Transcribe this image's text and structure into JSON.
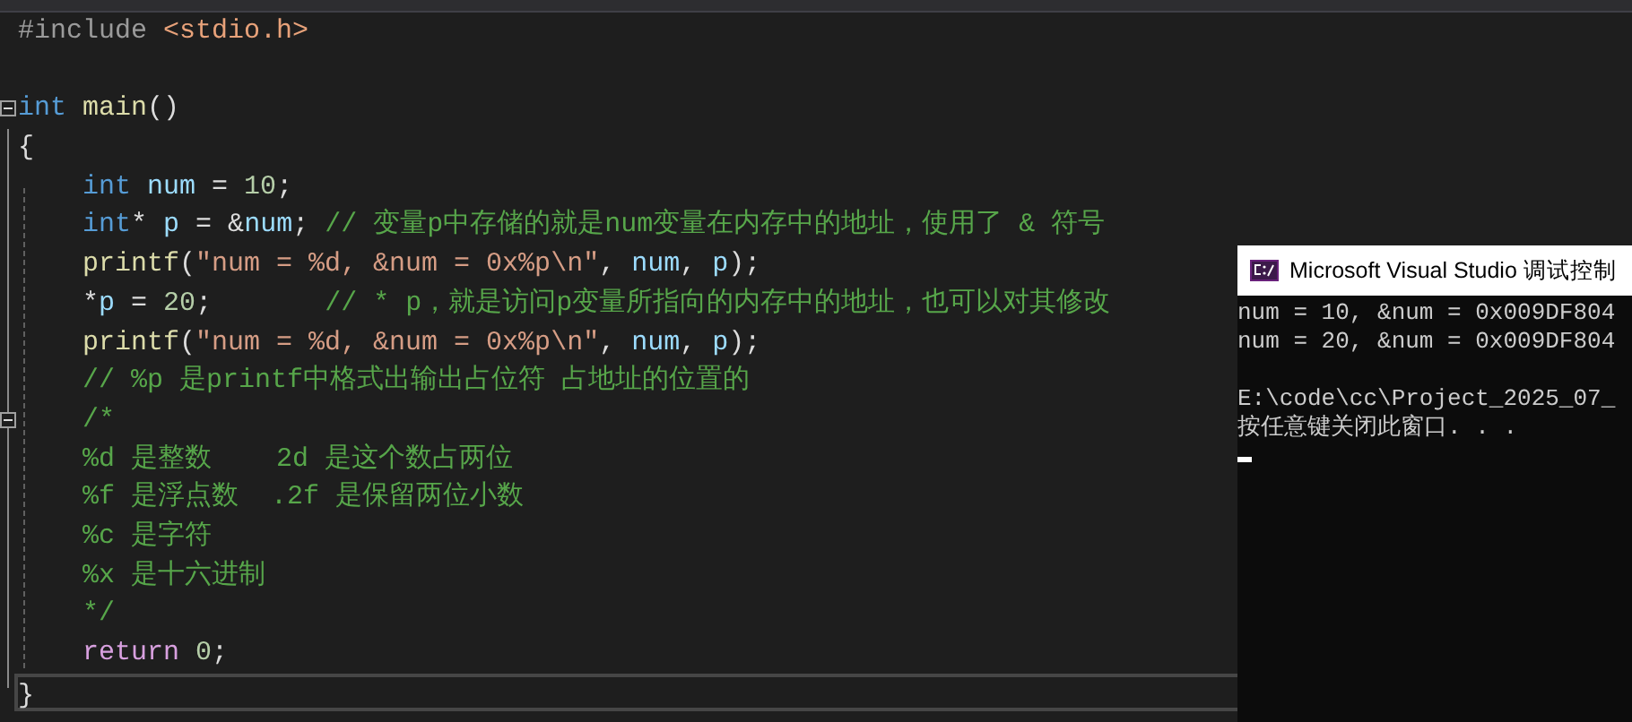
{
  "editor": {
    "lines": [
      {
        "kind": "code",
        "indented": false,
        "collapsible": false,
        "current": false,
        "tokens": [
          {
            "kind": "preproc",
            "text": "#include "
          },
          {
            "kind": "include",
            "text": "<stdio.h>"
          }
        ]
      },
      {
        "kind": "blank",
        "collapsible": false,
        "current": false
      },
      {
        "kind": "code",
        "indented": false,
        "collapsible": true,
        "current": false,
        "tokens": [
          {
            "kind": "keyword",
            "text": "int "
          },
          {
            "kind": "function",
            "text": "main"
          },
          {
            "kind": "plain",
            "text": "()"
          }
        ]
      },
      {
        "kind": "code",
        "indented": false,
        "collapsible": false,
        "current": false,
        "tokens": [
          {
            "kind": "plain",
            "text": "{"
          }
        ]
      },
      {
        "kind": "code",
        "indented": true,
        "collapsible": false,
        "current": false,
        "tokens": [
          {
            "kind": "keyword",
            "text": "int "
          },
          {
            "kind": "variable",
            "text": "num"
          },
          {
            "kind": "plain",
            "text": " = "
          },
          {
            "kind": "number",
            "text": "10"
          },
          {
            "kind": "plain",
            "text": ";"
          }
        ]
      },
      {
        "kind": "code",
        "indented": true,
        "collapsible": false,
        "current": false,
        "tokens": [
          {
            "kind": "keyword",
            "text": "int"
          },
          {
            "kind": "plain",
            "text": "* "
          },
          {
            "kind": "variable",
            "text": "p"
          },
          {
            "kind": "plain",
            "text": " = &"
          },
          {
            "kind": "variable",
            "text": "num"
          },
          {
            "kind": "plain",
            "text": "; "
          },
          {
            "kind": "comment",
            "text": "// 变量p中存储的就是num变量在内存中的地址，使用了 & 符号"
          }
        ]
      },
      {
        "kind": "code",
        "indented": true,
        "collapsible": false,
        "current": false,
        "tokens": [
          {
            "kind": "function",
            "text": "printf"
          },
          {
            "kind": "plain",
            "text": "("
          },
          {
            "kind": "string",
            "text": "\"num = %d, &num = 0x%p\\n\""
          },
          {
            "kind": "plain",
            "text": ", "
          },
          {
            "kind": "variable",
            "text": "num"
          },
          {
            "kind": "plain",
            "text": ", "
          },
          {
            "kind": "variable",
            "text": "p"
          },
          {
            "kind": "plain",
            "text": ");"
          }
        ]
      },
      {
        "kind": "code",
        "indented": true,
        "collapsible": false,
        "current": false,
        "tokens": [
          {
            "kind": "plain",
            "text": "*"
          },
          {
            "kind": "variable",
            "text": "p"
          },
          {
            "kind": "plain",
            "text": " = "
          },
          {
            "kind": "number",
            "text": "20"
          },
          {
            "kind": "plain",
            "text": ";       "
          },
          {
            "kind": "comment",
            "text": "// * p，就是访问p变量所指向的内存中的地址，也可以对其修改"
          }
        ]
      },
      {
        "kind": "code",
        "indented": true,
        "collapsible": false,
        "current": false,
        "tokens": [
          {
            "kind": "function",
            "text": "printf"
          },
          {
            "kind": "plain",
            "text": "("
          },
          {
            "kind": "string",
            "text": "\"num = %d, &num = 0x%p\\n\""
          },
          {
            "kind": "plain",
            "text": ", "
          },
          {
            "kind": "variable",
            "text": "num"
          },
          {
            "kind": "plain",
            "text": ", "
          },
          {
            "kind": "variable",
            "text": "p"
          },
          {
            "kind": "plain",
            "text": ");"
          }
        ]
      },
      {
        "kind": "code",
        "indented": true,
        "collapsible": false,
        "current": false,
        "tokens": [
          {
            "kind": "comment",
            "text": "// %p 是printf中格式出输出占位符 占地址的位置的"
          }
        ]
      },
      {
        "kind": "code",
        "indented": true,
        "collapsible": true,
        "current": false,
        "tokens": [
          {
            "kind": "comment",
            "text": "/*"
          }
        ]
      },
      {
        "kind": "code",
        "indented": true,
        "collapsible": false,
        "current": false,
        "tokens": [
          {
            "kind": "comment",
            "text": "%d 是整数    2d 是这个数占两位"
          }
        ]
      },
      {
        "kind": "code",
        "indented": true,
        "collapsible": false,
        "current": false,
        "tokens": [
          {
            "kind": "comment",
            "text": "%f 是浮点数  .2f 是保留两位小数"
          }
        ]
      },
      {
        "kind": "code",
        "indented": true,
        "collapsible": false,
        "current": false,
        "tokens": [
          {
            "kind": "comment",
            "text": "%c 是字符"
          }
        ]
      },
      {
        "kind": "code",
        "indented": true,
        "collapsible": false,
        "current": false,
        "tokens": [
          {
            "kind": "comment",
            "text": "%x 是十六进制"
          }
        ]
      },
      {
        "kind": "code",
        "indented": true,
        "collapsible": false,
        "current": false,
        "tokens": [
          {
            "kind": "comment",
            "text": "*/"
          }
        ]
      },
      {
        "kind": "code",
        "indented": true,
        "collapsible": false,
        "current": false,
        "tokens": [
          {
            "kind": "control",
            "text": "return "
          },
          {
            "kind": "number",
            "text": "0"
          },
          {
            "kind": "plain",
            "text": ";"
          }
        ]
      },
      {
        "kind": "code",
        "indented": false,
        "collapsible": false,
        "current": true,
        "tokens": [
          {
            "kind": "plain",
            "text": "}"
          }
        ]
      }
    ]
  },
  "console": {
    "title": "Microsoft Visual Studio 调试控制",
    "lines": [
      {
        "kind": "text",
        "text": "num = 10, &num = 0x009DF804"
      },
      {
        "kind": "text",
        "text": "num = 20, &num = 0x009DF804"
      },
      {
        "kind": "blank"
      },
      {
        "kind": "text",
        "text": "E:\\code\\cc\\Project_2025_07_"
      },
      {
        "kind": "text",
        "text": "按任意键关闭此窗口. . ."
      }
    ]
  }
}
